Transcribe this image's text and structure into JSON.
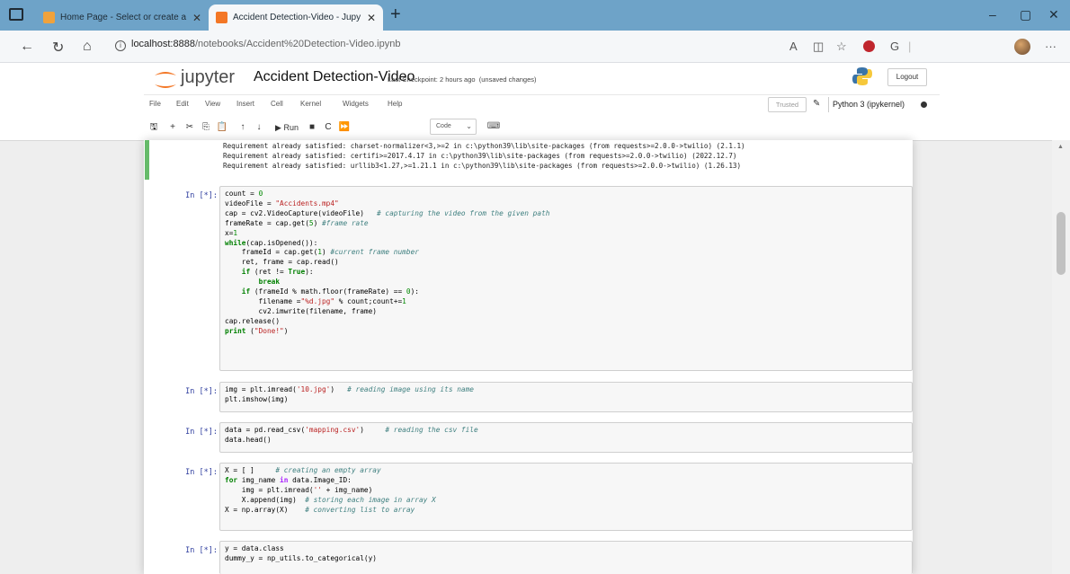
{
  "browser": {
    "tabs": [
      {
        "title": "Home Page - Select or create a n",
        "active": false
      },
      {
        "title": "Accident Detection-Video - Jupy",
        "active": true
      }
    ],
    "new_tab": "+",
    "window_controls": {
      "minimize": "–",
      "maximize": "▢",
      "close": "✕"
    },
    "url_host": "localhost:8888",
    "url_path": "/notebooks/Accident%20Detection-Video.ipynb",
    "icons": [
      "back-icon",
      "reload-icon",
      "home-icon",
      "info-icon",
      "read-aloud-icon",
      "split-screen-icon",
      "favorite-icon",
      "extension-icon",
      "copilot-icon",
      "profile-avatar",
      "more-icon"
    ]
  },
  "jupyter": {
    "brand": "jupyter",
    "notebook_name": "Accident Detection-Video",
    "checkpoint": "Last Checkpoint: 2 hours ago",
    "unsaved": "(unsaved changes)",
    "logout": "Logout",
    "menu": [
      "File",
      "Edit",
      "View",
      "Insert",
      "Cell",
      "Kernel",
      "Widgets",
      "Help"
    ],
    "trusted": "Trusted",
    "kernel": "Python 3 (ipykernel)",
    "toolbar": {
      "run_label": "Run",
      "cell_type": "Code"
    }
  },
  "output": {
    "lines": [
      "Requirement already satisfied: charset-normalizer<3,>=2 in c:\\python39\\lib\\site-packages (from requests>=2.0.0->twilio) (2.1.1)",
      "Requirement already satisfied: certifi>=2017.4.17 in c:\\python39\\lib\\site-packages (from requests>=2.0.0->twilio) (2022.12.7)",
      "Requirement already satisfied: urllib3<1.27,>=1.21.1 in c:\\python39\\lib\\site-packages (from requests>=2.0.0->twilio) (1.26.13)"
    ]
  },
  "cells": [
    {
      "prompt": "In [*]:"
    },
    {
      "prompt": "In [*]:"
    },
    {
      "prompt": "In [*]:"
    },
    {
      "prompt": "In [*]:"
    },
    {
      "prompt": "In [*]:"
    }
  ]
}
